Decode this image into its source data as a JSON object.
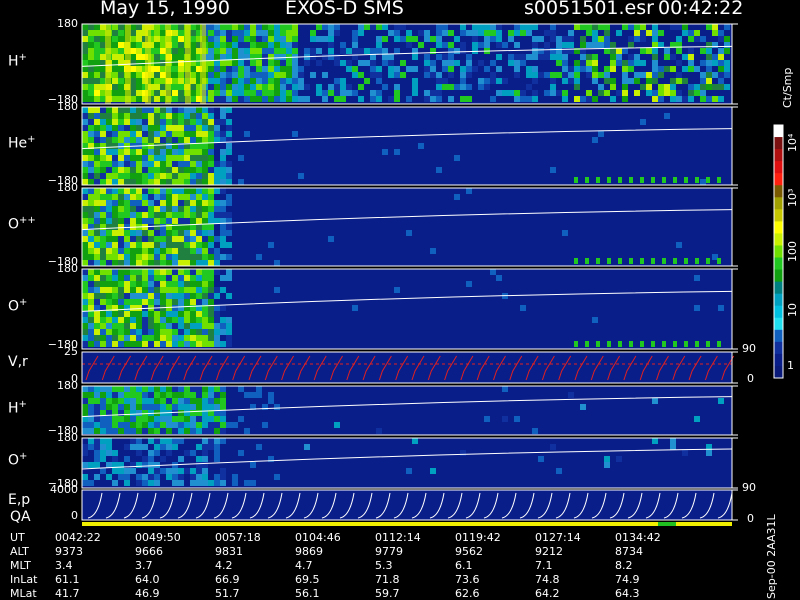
{
  "header": {
    "date": "May 15, 1990",
    "instrument": "EXOS-D SMS",
    "file": "s0051501.esr",
    "time": "00:42:22"
  },
  "panels": [
    {
      "label": "H",
      "sup": "+",
      "ytop": "180",
      "ybot": "−180"
    },
    {
      "label": "He",
      "sup": "+",
      "ytop": "180",
      "ybot": "−180"
    },
    {
      "label": "O",
      "sup": "++",
      "ytop": "180",
      "ybot": "−180"
    },
    {
      "label": "O",
      "sup": "+",
      "ytop": "180",
      "ybot": "−180"
    },
    {
      "label": "V,r",
      "sup": "",
      "ytop": "25",
      "ybot": "0"
    },
    {
      "label": "H",
      "sup": "+",
      "ytop": "180",
      "ybot": "−180"
    },
    {
      "label": "O",
      "sup": "+",
      "ytop": "180",
      "ybot": "−180"
    },
    {
      "label": "E,p",
      "sup": "",
      "ytop": "4000",
      "ybot": "0"
    }
  ],
  "qa_label": "QA",
  "colorbar": {
    "unit": "Ct/Smp",
    "ticks": [
      "10⁴",
      "10³",
      "100",
      "10",
      "1"
    ],
    "colors": [
      "#ffffff",
      "#7a1010",
      "#b01010",
      "#e01010",
      "#ff2010",
      "#7a5a00",
      "#a0a000",
      "#c8c800",
      "#ffff00",
      "#c8f000",
      "#70e000",
      "#20c820",
      "#10a010",
      "#008080",
      "#00a0c0",
      "#00c0e0",
      "#20e0f0",
      "#1060c0",
      "#1030a0",
      "#0a1e8a",
      "#0a1a7a"
    ]
  },
  "right_ticks": [
    {
      "value": "90"
    },
    {
      "value": "0"
    },
    {
      "value": "90"
    },
    {
      "value": "0"
    }
  ],
  "footer": {
    "code": "Sep-00 2AA31L"
  },
  "table": {
    "rows": [
      {
        "name": "UT",
        "values": [
          "0042:22",
          "0049:50",
          "0057:18",
          "0104:46",
          "0112:14",
          "0119:42",
          "0127:14",
          "0134:42"
        ]
      },
      {
        "name": "ALT",
        "values": [
          "9373",
          "9666",
          "9831",
          "9869",
          "9779",
          "9562",
          "9212",
          "8734"
        ]
      },
      {
        "name": "MLT",
        "values": [
          "3.4",
          "3.7",
          "4.2",
          "4.7",
          "5.3",
          "6.1",
          "7.1",
          "8.2"
        ]
      },
      {
        "name": "InLat",
        "values": [
          "61.1",
          "64.0",
          "66.9",
          "69.5",
          "71.8",
          "73.6",
          "74.8",
          "74.9"
        ]
      },
      {
        "name": "MLat",
        "values": [
          "41.7",
          "46.9",
          "51.7",
          "56.1",
          "59.7",
          "62.6",
          "64.2",
          "64.3"
        ]
      }
    ]
  },
  "chart_data": {
    "type": "heatmap",
    "title": "May 15, 1990   EXOS-D SMS",
    "x_tick_labels": [
      "0042:22",
      "0049:50",
      "0057:18",
      "0104:46",
      "0112:14",
      "0119:42",
      "0127:14",
      "0134:42"
    ],
    "colorbar_label": "Ct/Smp",
    "colorbar_scale": "log",
    "colorbar_range": [
      1,
      10000
    ]
  }
}
